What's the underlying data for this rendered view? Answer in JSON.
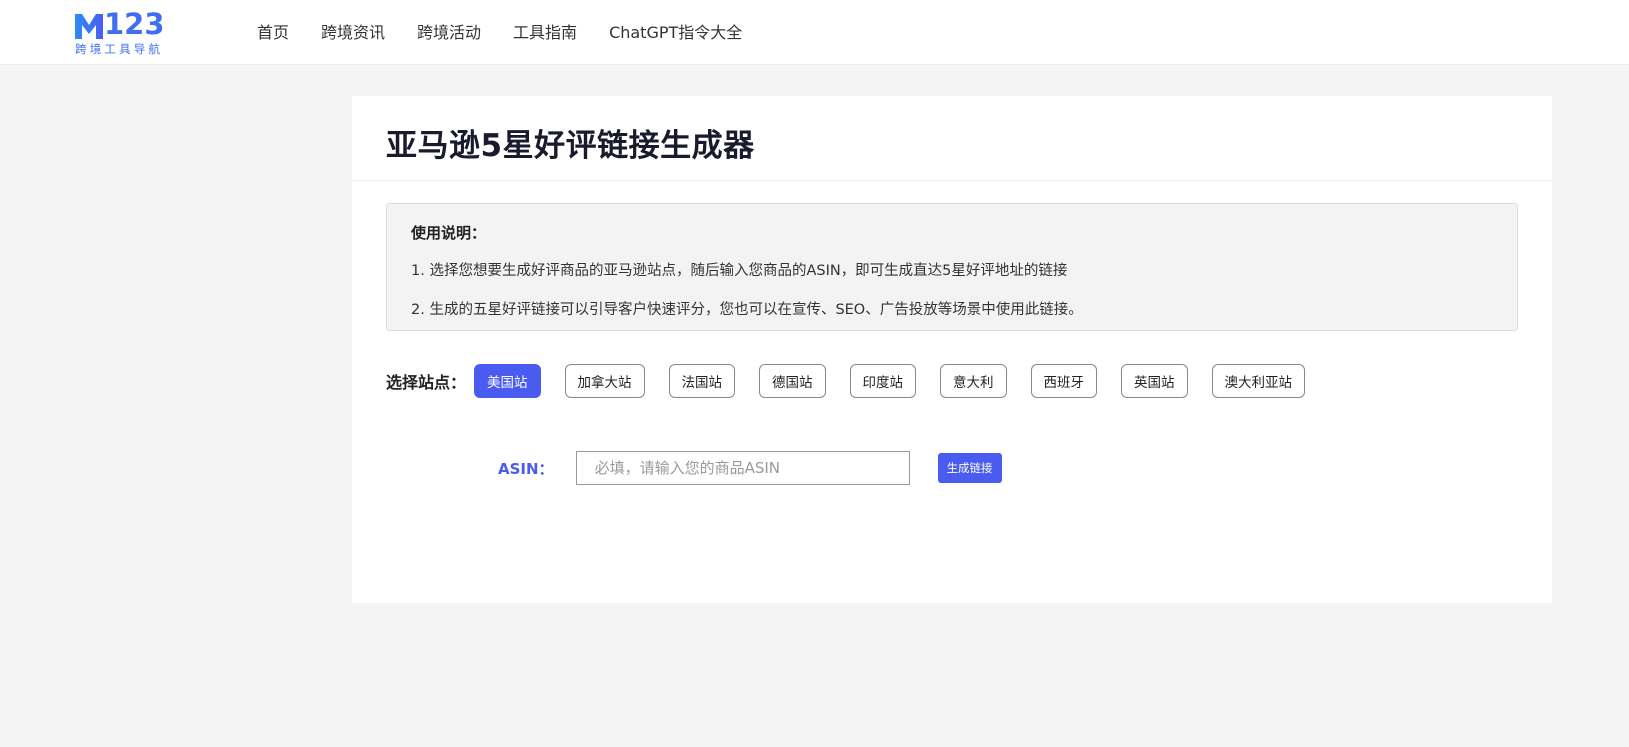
{
  "header": {
    "logo_number": "123",
    "logo_subtitle": "跨境工具导航",
    "nav": [
      "首页",
      "跨境资讯",
      "跨境活动",
      "工具指南",
      "ChatGPT指令大全"
    ]
  },
  "page": {
    "title": "亚马逊5星好评链接生成器",
    "notice_title": "使用说明：",
    "notice_lines": [
      "1. 选择您想要生成好评商品的亚马逊站点，随后输入您商品的ASIN，即可生成直达5星好评地址的链接",
      "2. 生成的五星好评链接可以引导客户快速评分，您也可以在宣传、SEO、广告投放等场景中使用此链接。"
    ],
    "sites_label": "选择站点：",
    "sites": [
      "美国站",
      "加拿大站",
      "法国站",
      "德国站",
      "印度站",
      "意大利",
      "西班牙",
      "英国站",
      "澳大利亚站"
    ],
    "selected_site": "美国站",
    "asin_label": "ASIN：",
    "asin_value": "",
    "asin_placeholder": "必填，请输入您的商品ASIN",
    "generate_label": "生成链接"
  },
  "colors": {
    "accent": "#4a5cf0",
    "brand_blue": "#3f6ff0",
    "background": "#f4f4f4"
  }
}
